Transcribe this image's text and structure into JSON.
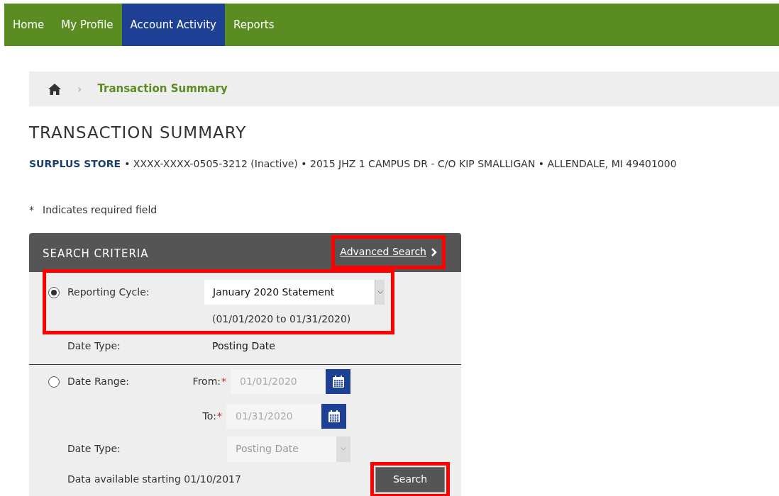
{
  "nav": [
    {
      "label": "Home",
      "selected": false
    },
    {
      "label": "My Profile",
      "selected": false
    },
    {
      "label": "Account Activity",
      "selected": true
    },
    {
      "label": "Reports",
      "selected": false
    }
  ],
  "breadcrumb": {
    "current": "Transaction Summary",
    "separator": "›"
  },
  "title": "TRANSACTION SUMMARY",
  "account_info": {
    "name": "SURPLUS STORE",
    "details": "• XXXX-XXXX-0505-3212 (Inactive) • 2015 JHZ 1 CAMPUS DR - C/O KIP SMALLIGAN • ALLENDALE, MI 49401000"
  },
  "required_note": {
    "mark": "*",
    "text": "Indicates required field"
  },
  "search_criteria": {
    "title": "SEARCH CRITERIA",
    "advanced_search": {
      "label": "Advanced Search",
      "highlighted": true
    },
    "reporting_cycle": {
      "label": "Reporting Cycle:",
      "selected": true,
      "value": "January 2020 Statement",
      "range": "(01/01/2020 to 01/31/2020)",
      "highlighted": true,
      "date_type_label": "Date Type:",
      "date_type": "Posting Date"
    },
    "date_range": {
      "label": "Date Range:",
      "selected": false,
      "from_label": "From:",
      "from": "01/01/2020",
      "to_label": "To:",
      "to": "01/31/2020",
      "required_mark": "*",
      "date_type_label": "Date Type:",
      "date_type": "Posting Date"
    },
    "availability": "Data available starting 01/10/2017",
    "search_button": {
      "label": "Search",
      "highlighted": true
    }
  }
}
